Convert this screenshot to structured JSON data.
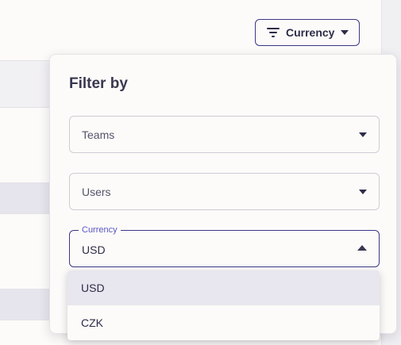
{
  "top_button": {
    "label": "Currency",
    "icon": "filter-icon"
  },
  "panel": {
    "title": "Filter by",
    "teams_select": {
      "placeholder": "Teams"
    },
    "users_select": {
      "placeholder": "Users"
    },
    "currency_select": {
      "label": "Currency",
      "value": "USD",
      "expanded": true
    }
  },
  "dropdown": {
    "options": [
      {
        "label": "USD",
        "selected": true
      },
      {
        "label": "CZK",
        "selected": false
      }
    ]
  },
  "colors": {
    "accent": "#3c3787",
    "floating_label": "#5a55c4",
    "selected_option_bg": "#e8e6ee"
  }
}
